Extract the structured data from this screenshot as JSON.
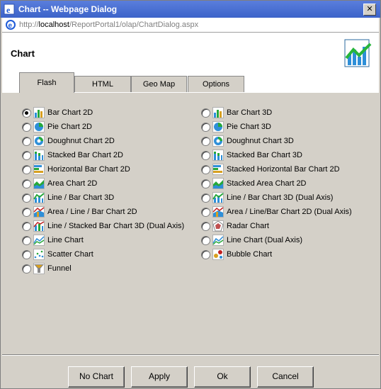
{
  "window": {
    "title": "Chart -- Webpage Dialog",
    "close_glyph": "✕"
  },
  "address": {
    "prefix": "http://",
    "host": "localhost",
    "path": "/ReportPortal1/olap/ChartDialog.aspx"
  },
  "header": {
    "title": "Chart",
    "logo_icon": "chart-logo-icon"
  },
  "tabs": [
    {
      "label": "Flash",
      "active": true
    },
    {
      "label": "HTML",
      "active": false
    },
    {
      "label": "Geo Map",
      "active": false
    },
    {
      "label": "Options",
      "active": false
    }
  ],
  "selected": "Bar Chart 2D",
  "options_left": [
    {
      "label": "Bar Chart 2D",
      "icon": "bar-chart-icon",
      "checked": true
    },
    {
      "label": "Pie Chart 2D",
      "icon": "pie-chart-icon",
      "checked": false
    },
    {
      "label": "Doughnut Chart 2D",
      "icon": "doughnut-chart-icon",
      "checked": false
    },
    {
      "label": "Stacked Bar Chart 2D",
      "icon": "stacked-bar-chart-icon",
      "checked": false
    },
    {
      "label": "Horizontal Bar Chart 2D",
      "icon": "horizontal-bar-chart-icon",
      "checked": false
    },
    {
      "label": "Area Chart 2D",
      "icon": "area-chart-icon",
      "checked": false
    },
    {
      "label": "Line / Bar Chart 3D",
      "icon": "line-bar-chart-icon",
      "checked": false
    },
    {
      "label": "Area / Line / Bar Chart 2D",
      "icon": "area-line-bar-chart-icon",
      "checked": false
    },
    {
      "label": "Line / Stacked Bar Chart 3D (Dual Axis)",
      "icon": "line-stacked-bar-chart-icon",
      "checked": false
    },
    {
      "label": "Line Chart",
      "icon": "line-chart-icon",
      "checked": false
    },
    {
      "label": "Scatter Chart",
      "icon": "scatter-chart-icon",
      "checked": false
    },
    {
      "label": "Funnel",
      "icon": "funnel-icon",
      "checked": false
    }
  ],
  "options_right": [
    {
      "label": "Bar Chart 3D",
      "icon": "bar-chart-icon",
      "checked": false
    },
    {
      "label": "Pie Chart 3D",
      "icon": "pie-chart-icon",
      "checked": false
    },
    {
      "label": "Doughnut Chart 3D",
      "icon": "doughnut-chart-icon",
      "checked": false
    },
    {
      "label": "Stacked Bar Chart 3D",
      "icon": "stacked-bar-chart-icon",
      "checked": false
    },
    {
      "label": "Stacked Horizontal Bar Chart 2D",
      "icon": "horizontal-bar-chart-icon",
      "checked": false
    },
    {
      "label": "Stacked Area Chart 2D",
      "icon": "area-chart-icon",
      "checked": false
    },
    {
      "label": "Line / Bar Chart 3D (Dual Axis)",
      "icon": "line-bar-chart-icon",
      "checked": false
    },
    {
      "label": "Area / Line/Bar Chart 2D (Dual Axis)",
      "icon": "area-line-bar-chart-icon",
      "checked": false
    },
    {
      "label": "Radar Chart",
      "icon": "radar-chart-icon",
      "checked": false
    },
    {
      "label": "Line Chart (Dual Axis)",
      "icon": "line-chart-icon",
      "checked": false
    },
    {
      "label": "Bubble Chart",
      "icon": "bubble-chart-icon",
      "checked": false
    }
  ],
  "buttons": {
    "no_chart": "No Chart",
    "apply": "Apply",
    "ok": "Ok",
    "cancel": "Cancel"
  }
}
